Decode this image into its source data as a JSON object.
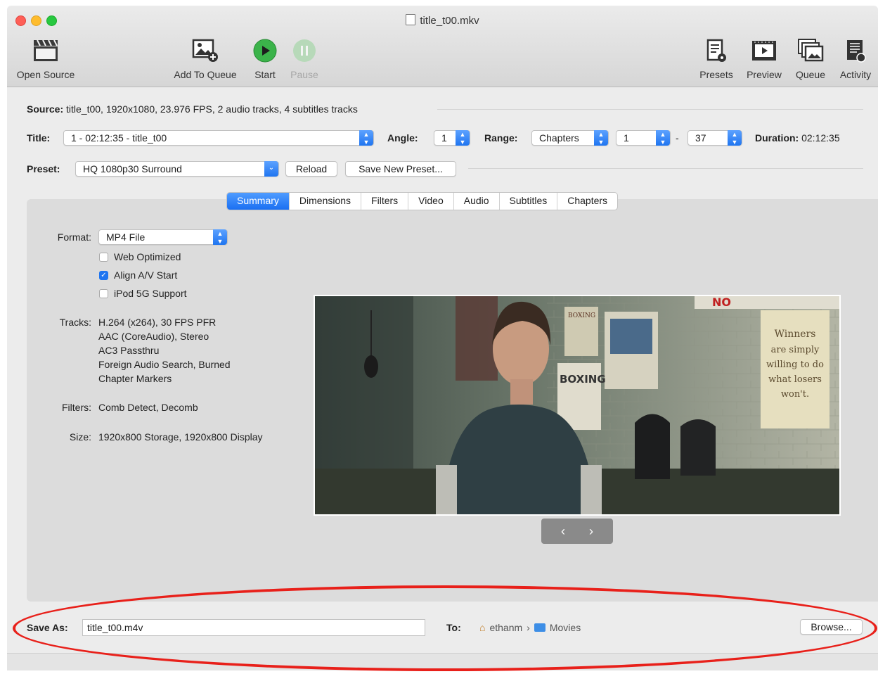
{
  "window": {
    "title": "title_t00.mkv"
  },
  "toolbar": {
    "open_source": "Open Source",
    "add_to_queue": "Add To Queue",
    "start": "Start",
    "pause": "Pause",
    "presets": "Presets",
    "preview": "Preview",
    "queue": "Queue",
    "activity": "Activity"
  },
  "source": {
    "label": "Source:",
    "value": "title_t00, 1920x1080, 23.976 FPS, 2 audio tracks, 4 subtitles tracks"
  },
  "title_row": {
    "title_label": "Title:",
    "title_value": "1 - 02:12:35 - title_t00",
    "angle_label": "Angle:",
    "angle_value": "1",
    "range_label": "Range:",
    "range_type": "Chapters",
    "range_start": "1",
    "range_dash": "-",
    "range_end": "37",
    "duration_label": "Duration:",
    "duration_value": "02:12:35"
  },
  "preset_row": {
    "label": "Preset:",
    "value": "HQ 1080p30 Surround",
    "reload": "Reload",
    "save_new": "Save New Preset..."
  },
  "tabs": [
    "Summary",
    "Dimensions",
    "Filters",
    "Video",
    "Audio",
    "Subtitles",
    "Chapters"
  ],
  "summary": {
    "format_label": "Format:",
    "format_value": "MP4 File",
    "web_optimized": "Web Optimized",
    "web_optimized_checked": false,
    "align_av": "Align A/V Start",
    "align_av_checked": true,
    "ipod": "iPod 5G Support",
    "ipod_checked": false,
    "tracks_label": "Tracks:",
    "tracks": [
      "H.264 (x264), 30 FPS PFR",
      "AAC (CoreAudio), Stereo",
      "AC3 Passthru",
      "Foreign Audio Search, Burned",
      "Chapter Markers"
    ],
    "filters_label": "Filters:",
    "filters_value": "Comb Detect, Decomb",
    "size_label": "Size:",
    "size_value": "1920x800 Storage, 1920x800 Display"
  },
  "preview_image": {
    "poster_1": "BOXING",
    "poster_2": "BOXING",
    "sign_line_1": "Winners",
    "sign_line_2": "are simply",
    "sign_line_3": "willing to do",
    "sign_line_4": "what losers",
    "sign_line_5": "won't.",
    "banner": "NO"
  },
  "bottom": {
    "save_as_label": "Save As:",
    "save_as_value": "title_t00.m4v",
    "to_label": "To:",
    "path_home": "ethanm",
    "path_sep": "›",
    "path_folder": "Movies",
    "browse": "Browse..."
  },
  "colors": {
    "accent": "#1f75f0",
    "annotation": "#e8201a"
  }
}
